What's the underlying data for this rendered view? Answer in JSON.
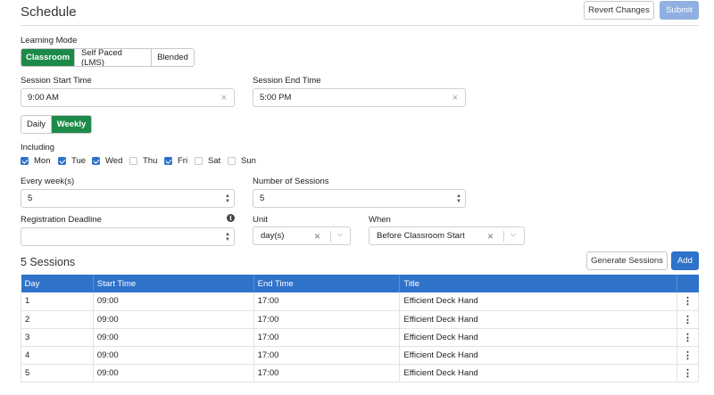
{
  "header": {
    "title": "Schedule",
    "revert_label": "Revert Changes",
    "submit_label": "Submit"
  },
  "learning_mode": {
    "label": "Learning Mode",
    "options": [
      "Classroom",
      "Self Paced (LMS)",
      "Blended"
    ],
    "selected": "Classroom"
  },
  "session_start": {
    "label": "Session Start Time",
    "value": "9:00 AM"
  },
  "session_end": {
    "label": "Session End Time",
    "value": "5:00 PM"
  },
  "frequency": {
    "options": [
      "Daily",
      "Weekly"
    ],
    "selected": "Weekly"
  },
  "including": {
    "label": "Including",
    "days": [
      {
        "name": "Mon",
        "checked": true
      },
      {
        "name": "Tue",
        "checked": true
      },
      {
        "name": "Wed",
        "checked": true
      },
      {
        "name": "Thu",
        "checked": false
      },
      {
        "name": "Fri",
        "checked": true
      },
      {
        "name": "Sat",
        "checked": false
      },
      {
        "name": "Sun",
        "checked": false
      }
    ]
  },
  "every_weeks": {
    "label": "Every week(s)",
    "value": "5"
  },
  "number_of_sessions": {
    "label": "Number of Sessions",
    "value": "5"
  },
  "registration_deadline": {
    "label": "Registration Deadline",
    "value": ""
  },
  "unit": {
    "label": "Unit",
    "value": "day(s)"
  },
  "when": {
    "label": "When",
    "value": "Before Classroom Start"
  },
  "sessions": {
    "title": "5 Sessions",
    "generate_label": "Generate Sessions",
    "add_label": "Add",
    "columns": [
      "Day",
      "Start Time",
      "End Time",
      "Title"
    ],
    "rows": [
      {
        "day": "1",
        "start": "09:00",
        "end": "17:00",
        "title": "Efficient Deck Hand"
      },
      {
        "day": "2",
        "start": "09:00",
        "end": "17:00",
        "title": "Efficient Deck Hand"
      },
      {
        "day": "3",
        "start": "09:00",
        "end": "17:00",
        "title": "Efficient Deck Hand"
      },
      {
        "day": "4",
        "start": "09:00",
        "end": "17:00",
        "title": "Efficient Deck Hand"
      },
      {
        "day": "5",
        "start": "09:00",
        "end": "17:00",
        "title": "Efficient Deck Hand"
      }
    ]
  },
  "colors": {
    "accent_green": "#1d8a4a",
    "primary_blue": "#2f72c9",
    "disabled_blue": "#8fb0e0"
  },
  "icons": {
    "clear": "close-icon",
    "spinner": "spinner-arrows-icon",
    "chevron": "chevron-down-icon",
    "info": "info-icon",
    "row_menu": "kebab-menu-icon"
  }
}
